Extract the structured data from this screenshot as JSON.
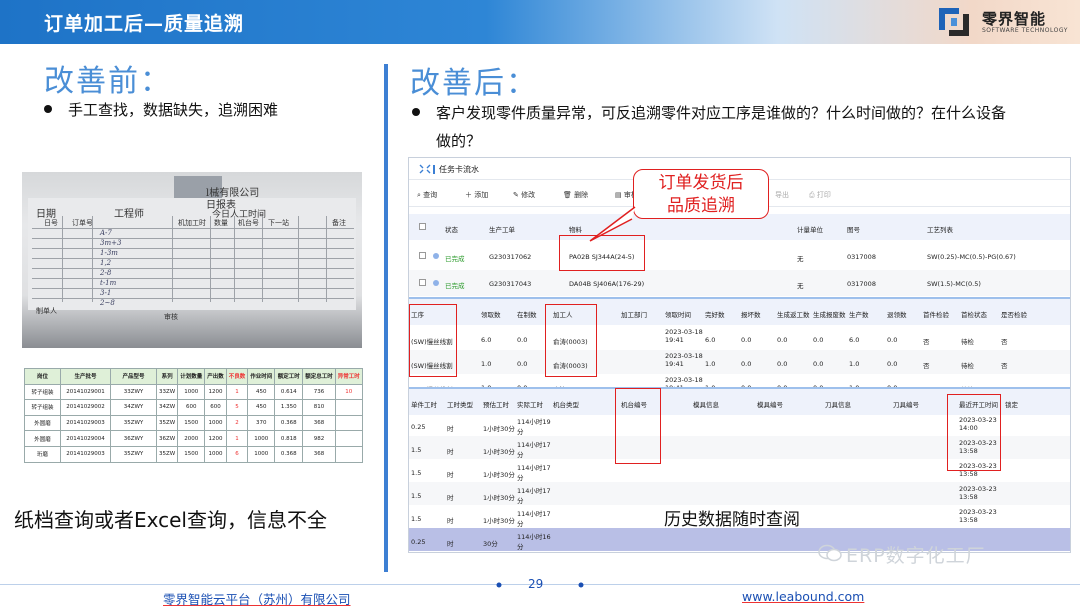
{
  "header": {
    "title": "订单加工后—质量追溯",
    "brand_name": "零界智能",
    "brand_sub": "SOFTWARE TECHNOLOGY",
    "accent": "#1e73c7"
  },
  "before": {
    "heading": "改善前：",
    "bullet": "手工查找，数据缺失，追溯困难",
    "photo_text": {
      "company": "l械有限公司",
      "daily": "日报表",
      "today": "今日人工时间",
      "cols": [
        "日期",
        "工程师",
        "机加工时",
        "数量",
        "机台号",
        "工时",
        "下一站",
        "备注"
      ],
      "cols2": [
        "日号",
        "订单号",
        "数量",
        "开工",
        "下一站"
      ],
      "footer": "制单人",
      "reviewer": "审核"
    },
    "table": {
      "headers": [
        "岗位",
        "生产批号",
        "产品型号",
        "系列",
        "计划数量",
        "产出数",
        "不良数",
        "作业时间",
        "额定工时",
        "额定总工时",
        "异常工时"
      ],
      "rows": [
        [
          "转子组装",
          "20141029001",
          "33ZWY",
          "33ZW",
          "1000",
          "1200",
          "1",
          "450",
          "0.614",
          "736",
          "10"
        ],
        [
          "转子组装",
          "20141029002",
          "34ZWY",
          "34ZW",
          "600",
          "600",
          "5",
          "450",
          "1.350",
          "810",
          ""
        ],
        [
          "外圆磨",
          "20141029003",
          "35ZWY",
          "35ZW",
          "1500",
          "1000",
          "2",
          "370",
          "0.368",
          "368",
          ""
        ],
        [
          "外圆磨",
          "20141029004",
          "36ZWY",
          "36ZW",
          "2000",
          "1200",
          "1",
          "1000",
          "0.818",
          "982",
          ""
        ],
        [
          "珩磨",
          "20141029003",
          "35ZWY",
          "35ZW",
          "1500",
          "1000",
          "6",
          "1000",
          "0.368",
          "368",
          ""
        ]
      ]
    },
    "caption": "纸档查询或者Excel查询，信息不全"
  },
  "after": {
    "heading": "改善后：",
    "bullet_line1": "客户发现零件质量异常，可反追溯零件对应工序是谁做的？什么时间做的？在什么设备",
    "bullet_line2": "做的？",
    "callout_line1": "订单发货后",
    "callout_line2": "品质追溯",
    "caption": "历史数据随时查阅",
    "app": {
      "title": "任务卡流水",
      "toolbar": [
        "查询",
        "添加",
        "修改",
        "删除",
        "审核",
        "导出",
        "打印"
      ],
      "grid1": {
        "headers": [
          "状态",
          "生产工单",
          "物料",
          "计量单位",
          "图号",
          "工艺列表"
        ],
        "rows": [
          [
            "已完成",
            "G230317062",
            "PA02B SJ344A(24-5)",
            "无",
            "0317008",
            "SW(0.25)-MC(0.5)-PG(0.67)"
          ],
          [
            "已完成",
            "G230317043",
            "DA04B SJ406A(176-29)",
            "无",
            "0317008",
            "SW(1.5)-MC(0.5)"
          ]
        ]
      },
      "grid2": {
        "headers": [
          "工序",
          "领取数",
          "在制数",
          "加工人",
          "加工部门",
          "领取时间",
          "完好数",
          "报坏数",
          "生成返工数",
          "生成报废数",
          "生产数",
          "退领数",
          "首件检验",
          "首检状态",
          "是否检验"
        ],
        "rows": [
          [
            "(SW)慢丝线割",
            "6.0",
            "0.0",
            "俞涛(0003)",
            "",
            "2023-03-18 19:41",
            "6.0",
            "0.0",
            "0.0",
            "0.0",
            "6.0",
            "0.0",
            "否",
            "待检",
            "否"
          ],
          [
            "(SW)慢丝线割",
            "1.0",
            "0.0",
            "俞涛(0003)",
            "",
            "2023-03-18 19:41",
            "1.0",
            "0.0",
            "0.0",
            "0.0",
            "1.0",
            "0.0",
            "否",
            "待检",
            "否"
          ],
          [
            "(SW)慢丝线割",
            "1.0",
            "0.0",
            "俞涛(0003)",
            "",
            "2023-03-18 19:41",
            "1.0",
            "0.0",
            "0.0",
            "0.0",
            "1.0",
            "0.0",
            "否",
            "待检",
            "否"
          ]
        ]
      },
      "grid3": {
        "headers": [
          "单件工时",
          "工时类型",
          "预估工时",
          "实际工时",
          "机台类型",
          "机台编号",
          "模具信息",
          "模具编号",
          "刀具信息",
          "刀具编号",
          "最近开工时间",
          "锁定"
        ],
        "rows": [
          [
            "0.25",
            "时",
            "1小时30分",
            "114小时19分",
            "2023-03-23 14:00"
          ],
          [
            "1.5",
            "时",
            "1小时30分",
            "114小时17分",
            "2023-03-23 13:58"
          ],
          [
            "1.5",
            "时",
            "1小时30分",
            "114小时17分",
            "2023-03-23 13:58"
          ],
          [
            "1.5",
            "时",
            "1小时30分",
            "114小时17分",
            "2023-03-23 13:58"
          ],
          [
            "1.5",
            "时",
            "1小时30分",
            "114小时17分",
            "2023-03-23 13:58"
          ],
          [
            "0.25",
            "时",
            "30分",
            "114小时16分",
            ""
          ]
        ]
      }
    }
  },
  "footer": {
    "company": "零界智能云平台（苏州）有限公司",
    "page": "29",
    "url": "www.leabound.com",
    "watermark": "ERP数字化工厂"
  }
}
